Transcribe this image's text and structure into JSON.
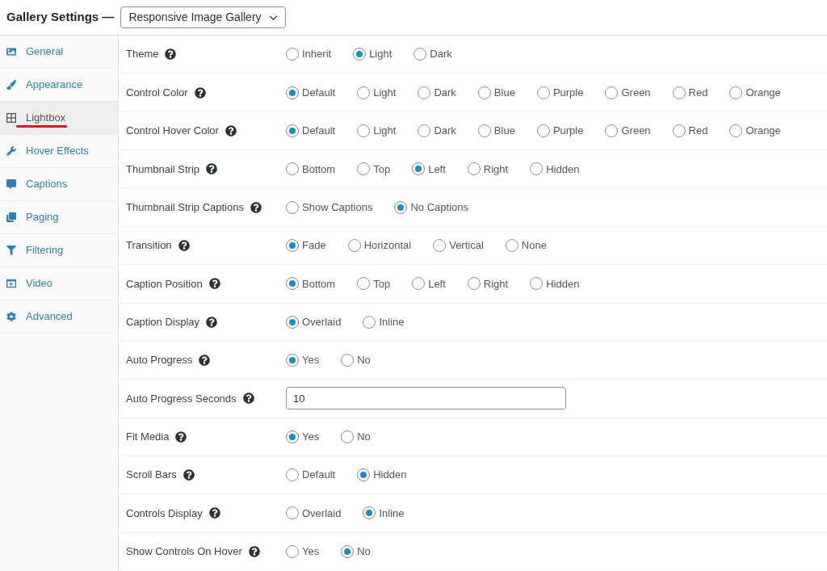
{
  "header": {
    "title": "Gallery Settings —",
    "gallery_select": {
      "value": "Responsive Image Gallery"
    }
  },
  "sidebar": {
    "items": [
      {
        "label": "General",
        "selected": false,
        "underlined": false
      },
      {
        "label": "Appearance",
        "selected": false,
        "underlined": false
      },
      {
        "label": "Lightbox",
        "selected": true,
        "underlined": true
      },
      {
        "label": "Hover Effects",
        "selected": false,
        "underlined": false
      },
      {
        "label": "Captions",
        "selected": false,
        "underlined": false
      },
      {
        "label": "Paging",
        "selected": false,
        "underlined": false
      },
      {
        "label": "Filtering",
        "selected": false,
        "underlined": false
      },
      {
        "label": "Video",
        "selected": false,
        "underlined": false
      },
      {
        "label": "Advanced",
        "selected": false,
        "underlined": false
      }
    ]
  },
  "settings": [
    {
      "label": "Theme",
      "kind": "radio",
      "options": [
        {
          "label": "Inherit",
          "selected": false
        },
        {
          "label": "Light",
          "selected": true
        },
        {
          "label": "Dark",
          "selected": false
        }
      ]
    },
    {
      "label": "Control Color",
      "kind": "radio",
      "options": [
        {
          "label": "Default",
          "selected": true
        },
        {
          "label": "Light",
          "selected": false
        },
        {
          "label": "Dark",
          "selected": false
        },
        {
          "label": "Blue",
          "selected": false
        },
        {
          "label": "Purple",
          "selected": false
        },
        {
          "label": "Green",
          "selected": false
        },
        {
          "label": "Red",
          "selected": false
        },
        {
          "label": "Orange",
          "selected": false
        }
      ]
    },
    {
      "label": "Control Hover Color",
      "kind": "radio",
      "options": [
        {
          "label": "Default",
          "selected": true
        },
        {
          "label": "Light",
          "selected": false
        },
        {
          "label": "Dark",
          "selected": false
        },
        {
          "label": "Blue",
          "selected": false
        },
        {
          "label": "Purple",
          "selected": false
        },
        {
          "label": "Green",
          "selected": false
        },
        {
          "label": "Red",
          "selected": false
        },
        {
          "label": "Orange",
          "selected": false
        }
      ]
    },
    {
      "label": "Thumbnail Strip",
      "kind": "radio",
      "options": [
        {
          "label": "Bottom",
          "selected": false
        },
        {
          "label": "Top",
          "selected": false
        },
        {
          "label": "Left",
          "selected": true
        },
        {
          "label": "Right",
          "selected": false
        },
        {
          "label": "Hidden",
          "selected": false
        }
      ]
    },
    {
      "label": "Thumbnail Strip Captions",
      "kind": "radio",
      "options": [
        {
          "label": "Show Captions",
          "selected": false
        },
        {
          "label": "No Captions",
          "selected": true
        }
      ]
    },
    {
      "label": "Transition",
      "kind": "radio",
      "options": [
        {
          "label": "Fade",
          "selected": true
        },
        {
          "label": "Horizontal",
          "selected": false
        },
        {
          "label": "Vertical",
          "selected": false
        },
        {
          "label": "None",
          "selected": false
        }
      ]
    },
    {
      "label": "Caption Position",
      "kind": "radio",
      "options": [
        {
          "label": "Bottom",
          "selected": true
        },
        {
          "label": "Top",
          "selected": false
        },
        {
          "label": "Left",
          "selected": false
        },
        {
          "label": "Right",
          "selected": false
        },
        {
          "label": "Hidden",
          "selected": false
        }
      ]
    },
    {
      "label": "Caption Display",
      "kind": "radio",
      "options": [
        {
          "label": "Overlaid",
          "selected": true
        },
        {
          "label": "Inline",
          "selected": false
        }
      ]
    },
    {
      "label": "Auto Progress",
      "kind": "radio",
      "options": [
        {
          "label": "Yes",
          "selected": true
        },
        {
          "label": "No",
          "selected": false
        }
      ]
    },
    {
      "label": "Auto Progress Seconds",
      "kind": "text",
      "value": "10"
    },
    {
      "label": "Fit Media",
      "kind": "radio",
      "options": [
        {
          "label": "Yes",
          "selected": true
        },
        {
          "label": "No",
          "selected": false
        }
      ]
    },
    {
      "label": "Scroll Bars",
      "kind": "radio",
      "options": [
        {
          "label": "Default",
          "selected": false
        },
        {
          "label": "Hidden",
          "selected": true
        }
      ]
    },
    {
      "label": "Controls Display",
      "kind": "radio",
      "options": [
        {
          "label": "Overlaid",
          "selected": false
        },
        {
          "label": "Inline",
          "selected": true
        }
      ]
    },
    {
      "label": "Show Controls On Hover",
      "kind": "radio",
      "options": [
        {
          "label": "Yes",
          "selected": false
        },
        {
          "label": "No",
          "selected": true
        }
      ]
    }
  ]
}
